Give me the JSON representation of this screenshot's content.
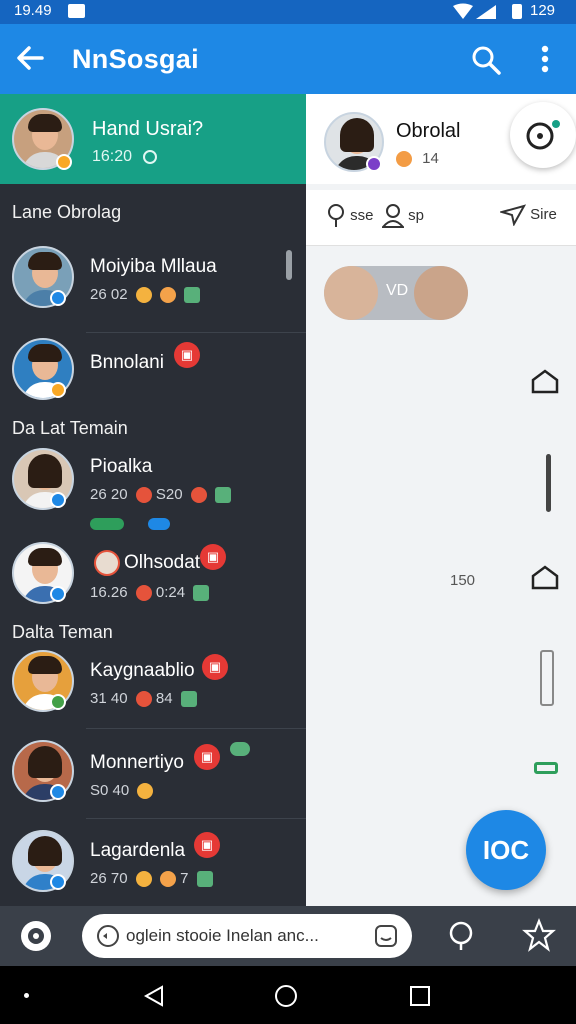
{
  "status_bar": {
    "time": "19.49",
    "battery": "129"
  },
  "app_bar": {
    "title": "NnSosgai"
  },
  "active_chat": {
    "name": "Hand Usrai?",
    "time": "16:20",
    "badge_color": "#f9a825"
  },
  "sections": {
    "recent": "Lane Obrolag",
    "friends_a": "Da Lat Temain",
    "friends_b": "Dalta Teman"
  },
  "contacts": [
    {
      "name": "Moiyiba Mllaua",
      "time": "26 02",
      "extra": "",
      "badge_color": "#1e88e5"
    },
    {
      "name": "Bnnolani",
      "time": "",
      "extra": "",
      "badge_color": "#f9a825"
    },
    {
      "name": "Pioalka",
      "time": "26 20",
      "extra": "S20",
      "badge_color": "#1e88e5"
    },
    {
      "name": "Olhsodat",
      "time": "16.26",
      "extra": "0:24",
      "badge_color": "#1e88e5"
    },
    {
      "name": "Kaygnaablio",
      "time": "31 40",
      "extra": "84",
      "badge_color": "#43a047"
    },
    {
      "name": "Monnertiyo",
      "time": "S0 40",
      "extra": "",
      "badge_color": "#1e88e5"
    },
    {
      "name": "Lagardenla",
      "time": "26 70",
      "extra": "7",
      "badge_color": "#1e88e5"
    }
  ],
  "right": {
    "contact_name": "Obrolal",
    "contact_meta": "14",
    "actions": {
      "a1": "sse",
      "a2": "sp",
      "a3": "Sire"
    },
    "media_label": "VD",
    "count": "150"
  },
  "fab": {
    "label": "IOC"
  },
  "composer": {
    "placeholder": "oglein stooie Inelan anc..."
  },
  "colors": {
    "primary": "#1e88e5",
    "accent_green": "#17a086",
    "red_badge": "#e53935"
  }
}
